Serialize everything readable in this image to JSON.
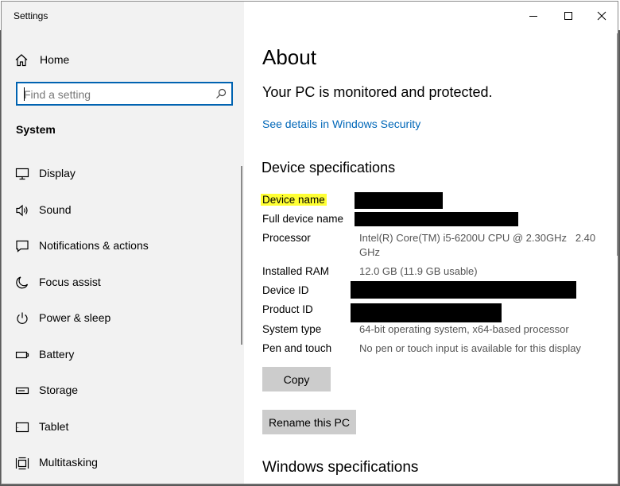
{
  "window": {
    "title": "Settings"
  },
  "sidebar": {
    "home_label": "Home",
    "search_placeholder": "Find a setting",
    "section_title": "System",
    "items": [
      {
        "label": "Display",
        "icon": "monitor-icon"
      },
      {
        "label": "Sound",
        "icon": "speaker-icon"
      },
      {
        "label": "Notifications & actions",
        "icon": "notification-icon"
      },
      {
        "label": "Focus assist",
        "icon": "moon-icon"
      },
      {
        "label": "Power & sleep",
        "icon": "power-icon"
      },
      {
        "label": "Battery",
        "icon": "battery-icon"
      },
      {
        "label": "Storage",
        "icon": "storage-icon"
      },
      {
        "label": "Tablet",
        "icon": "tablet-icon"
      },
      {
        "label": "Multitasking",
        "icon": "multitasking-icon"
      }
    ]
  },
  "main": {
    "title": "About",
    "status": "Your PC is monitored and protected.",
    "security_link": "See details in Windows Security",
    "specs_heading": "Device specifications",
    "specs": {
      "device_name_label": "Device name",
      "full_device_name_label": "Full device name",
      "processor_label": "Processor",
      "processor_value_line1": "Intel(R) Core(TM) i5-6200U CPU @ 2.30GHz   2.40",
      "processor_value_line2": "GHz",
      "ram_label": "Installed RAM",
      "ram_value": "12.0 GB (11.9 GB usable)",
      "device_id_label": "Device ID",
      "product_id_label": "Product ID",
      "system_type_label": "System type",
      "system_type_value": "64-bit operating system, x64-based processor",
      "pen_label": "Pen and touch",
      "pen_value": "No pen or touch input is available for this display"
    },
    "copy_button": "Copy",
    "rename_button": "Rename this PC",
    "windows_specs_heading": "Windows specifications"
  },
  "colors": {
    "accent": "#0063b1",
    "link": "#0067b8",
    "highlight": "#ffff33",
    "sidebar_bg": "#f2f2f2",
    "button_bg": "#cccccc"
  }
}
